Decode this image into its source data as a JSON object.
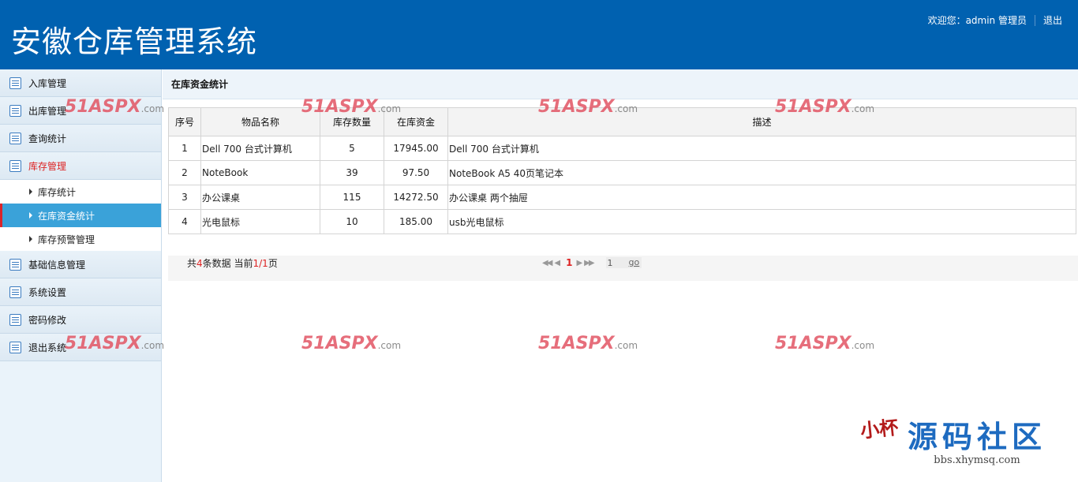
{
  "header": {
    "title": "安徽仓库管理系统",
    "welcome": "欢迎您：admin 管理员",
    "logout": "退出"
  },
  "sidebar": {
    "items": [
      {
        "label": "入库管理",
        "icon": "list-icon"
      },
      {
        "label": "出库管理",
        "icon": "list-icon"
      },
      {
        "label": "查询统计",
        "icon": "list-icon"
      },
      {
        "label": "库存管理",
        "icon": "list-icon",
        "active": true
      },
      {
        "label": "基础信息管理",
        "icon": "list-icon"
      },
      {
        "label": "系统设置",
        "icon": "list-icon"
      },
      {
        "label": "密码修改",
        "icon": "list-icon"
      },
      {
        "label": "退出系统",
        "icon": "list-icon"
      }
    ],
    "sub_items": [
      {
        "label": "库存统计"
      },
      {
        "label": "在库资金统计",
        "selected": true
      },
      {
        "label": "库存预警管理"
      }
    ]
  },
  "content": {
    "title": "在库资金统计",
    "table": {
      "headers": [
        "序号",
        "物品名称",
        "库存数量",
        "在库资金",
        "描述"
      ],
      "rows": [
        [
          "1",
          "Dell 700 台式计算机",
          "5",
          "17945.00",
          "Dell 700 台式计算机"
        ],
        [
          "2",
          "NoteBook",
          "39",
          "97.50",
          "NoteBook A5 40页笔记本"
        ],
        [
          "3",
          "办公课桌",
          "115",
          "14272.50",
          "办公课桌 两个抽屉"
        ],
        [
          "4",
          "光电鼠标",
          "10",
          "185.00",
          "usb光电鼠标"
        ]
      ]
    },
    "pager": {
      "prefix": "共",
      "total": "4",
      "mid": "条数据 当前",
      "current": "1",
      "slash": "/",
      "pages": "1",
      "suffix": "页",
      "page_number": "1",
      "page_input": "1",
      "go": "go"
    }
  },
  "watermark": {
    "text": "51ASPX",
    "suffix": ".com"
  },
  "signature": {
    "seal_text": "小杯",
    "brand": "源码社区",
    "url": "bbs.xhymsq.com"
  },
  "colors": {
    "header_bg": "#0061b0",
    "selected_bg": "#3aa2d9",
    "active_red": "#d22",
    "watermark": "#e25564"
  }
}
